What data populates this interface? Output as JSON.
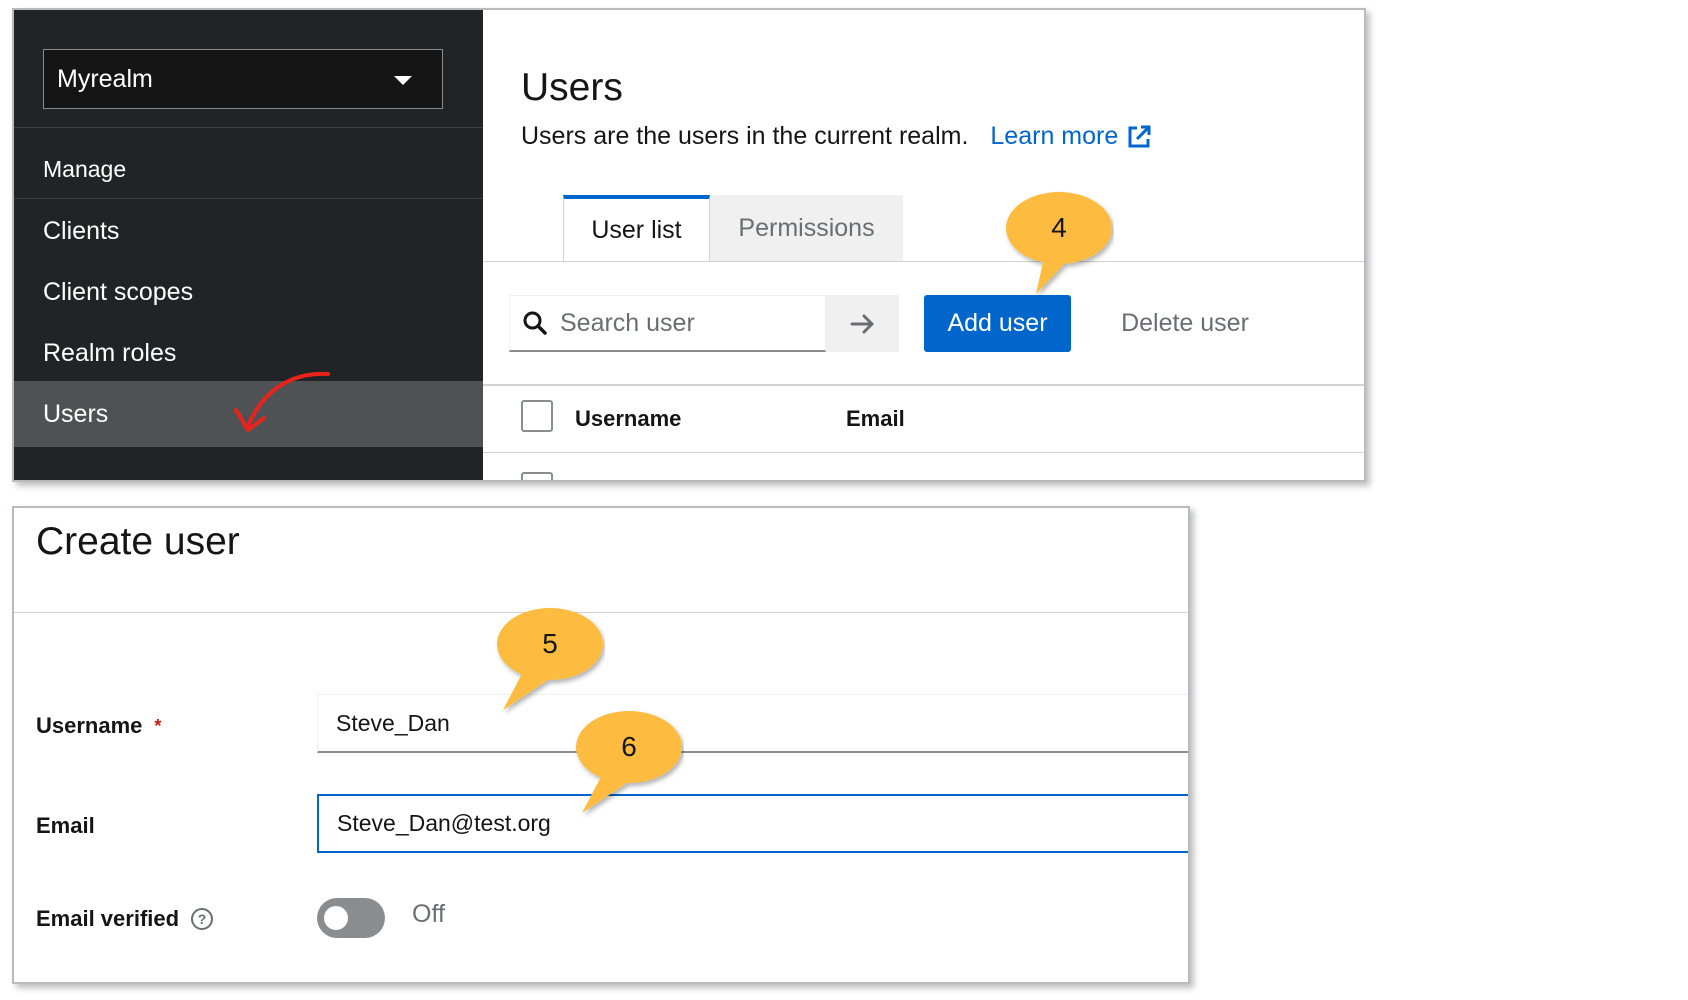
{
  "sidebar": {
    "realm": "Myrealm",
    "items": [
      {
        "label": "Manage",
        "type": "section"
      },
      {
        "label": "Clients"
      },
      {
        "label": "Client scopes"
      },
      {
        "label": "Realm roles"
      },
      {
        "label": "Users",
        "active": true
      }
    ]
  },
  "users_page": {
    "title": "Users",
    "description": "Users are the users in the current realm.",
    "learn_more": "Learn more",
    "tabs": [
      {
        "label": "User list",
        "active": true
      },
      {
        "label": "Permissions",
        "active": false
      }
    ],
    "search_placeholder": "Search user",
    "add_user": "Add user",
    "delete_user": "Delete user",
    "columns": [
      "Username",
      "Email"
    ]
  },
  "create_user": {
    "title": "Create user",
    "username_label": "Username",
    "required_mark": "*",
    "username_value": "Steve_Dan",
    "email_label": "Email",
    "email_value": "Steve_Dan@test.org",
    "email_verified_label": "Email verified",
    "email_verified_state": "Off",
    "help_icon": "?"
  },
  "callouts": [
    "4",
    "5",
    "6"
  ],
  "colors": {
    "sidebar_bg": "#212427",
    "active_item_bg": "#4f5255",
    "primary": "#0066cc",
    "callout": "#fdbc40",
    "annotation_arrow": "#e8231c"
  }
}
